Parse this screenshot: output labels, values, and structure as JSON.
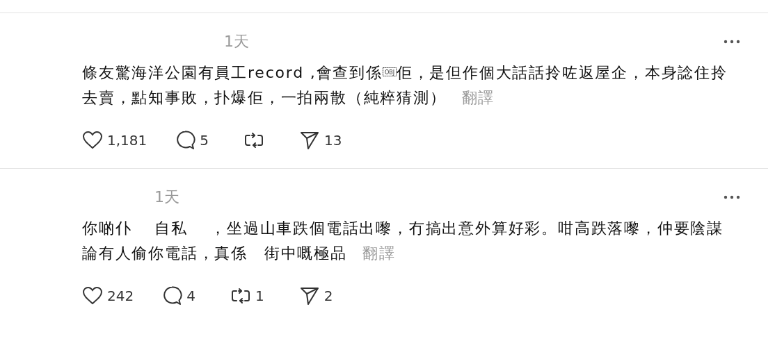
{
  "posts": [
    {
      "time": "1天",
      "text": [
        {
          "kind": "text",
          "value": "條友驚海洋公園有員工record ,會查到係"
        },
        {
          "kind": "object",
          "value": "OBJ"
        },
        {
          "kind": "text",
          "value": "佢，是但作個大話話拎咗返屋企，本身諗住拎去賣，點知事敗，扑爆佢，一拍兩散（純粹猜測）"
        }
      ],
      "translate": "翻譯",
      "likes": "1,181",
      "replies": "5",
      "shares": "13"
    },
    {
      "time": "1天",
      "text": [
        {
          "kind": "text",
          "value": "你啲仆　 自私　 ，坐過山車跌個電話出嚟，冇搞出意外算好彩。咁高跌落嚟，仲要陰謀論有人偷你電話，真係　街中嘅極品"
        }
      ],
      "translate": "翻譯",
      "likes": "242",
      "replies": "4",
      "reposts": "1",
      "shares": "2"
    }
  ]
}
